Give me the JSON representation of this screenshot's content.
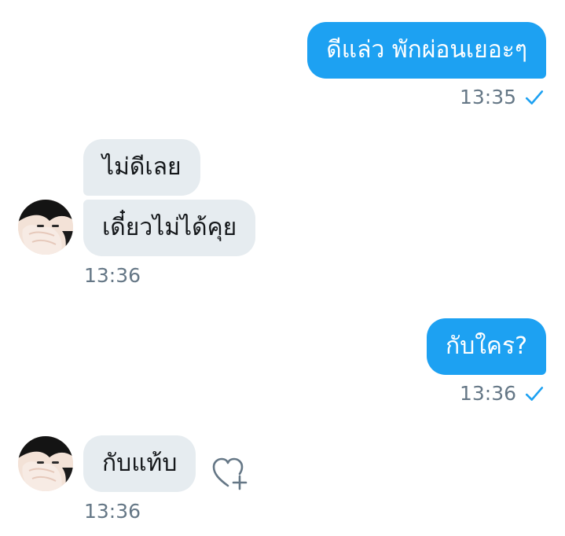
{
  "messages": [
    {
      "direction": "outgoing",
      "text": "ดีแล่ว พักผ่อนเยอะๆ",
      "time": "13:35",
      "status": "read-check-icon"
    },
    {
      "direction": "incoming",
      "text": "ไม่ดีเลย"
    },
    {
      "direction": "incoming",
      "text": "เดี๋ยวไม่ได้คุย",
      "time": "13:36"
    },
    {
      "direction": "outgoing",
      "text": "กับใคร?",
      "time": "13:36",
      "status": "read-check-icon"
    },
    {
      "direction": "incoming",
      "text": "กับแท้บ",
      "time": "13:36",
      "action_icon": "heart-plus-icon"
    }
  ],
  "colors": {
    "outgoing_bubble": "#1da1f2",
    "incoming_bubble": "#e6ecf0",
    "timestamp": "#657786",
    "check": "#1da1f2"
  }
}
